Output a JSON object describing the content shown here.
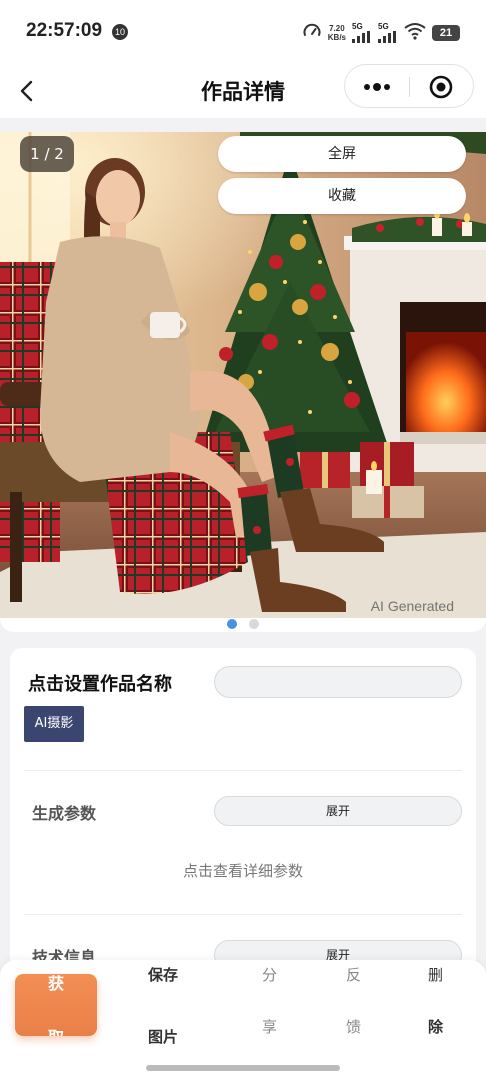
{
  "status_bar": {
    "time": "22:57:09",
    "notification_badge": "10",
    "net_speed_value": "7.20",
    "net_speed_unit": "KB/s",
    "sim1_label": "5G",
    "sim2_label": "5G",
    "battery": "21"
  },
  "nav": {
    "title": "作品详情"
  },
  "image_viewer": {
    "page_indicator": "1 / 2",
    "fullscreen_label": "全屏",
    "favorite_label": "收藏",
    "watermark": "AI Generated",
    "current_page": 1,
    "total_pages": 2,
    "active_dot_color": "#4a90e2",
    "inactive_dot_color": "#d8d8d8"
  },
  "details": {
    "work_name_prompt": "点击设置作品名称",
    "name_input_value": "",
    "tag": "AI摄影",
    "params_label": "生成参数",
    "params_expand": "展开",
    "params_hint": "点击查看详细参数",
    "tech_label": "技术信息",
    "tech_expand": "展开"
  },
  "bottom_bar": {
    "primary_top": "获",
    "primary_bottom": "取",
    "save_top": "保存",
    "save_bottom": "图片",
    "share_top": "分",
    "share_bottom": "享",
    "feedback_top": "反",
    "feedback_bottom": "馈",
    "delete_top": "删",
    "delete_bottom": "除",
    "accent_color": "#f08a4f"
  }
}
